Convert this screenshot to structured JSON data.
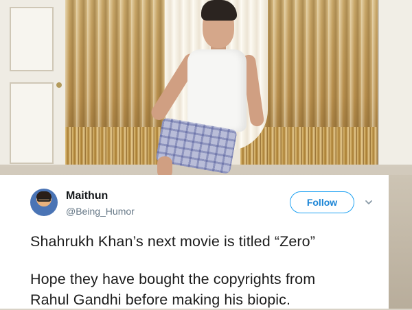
{
  "tweet": {
    "author_name": "Maithun",
    "author_handle": "@Being_Humor",
    "follow_label": "Follow",
    "text_line1": "Shahrukh Khan’s next movie is titled “Zero”",
    "text_line2": "Hope they have bought the copyrights from",
    "text_line3": "Rahul Gandhi before making his biopic."
  },
  "icons": {
    "avatar": "avatar",
    "menu": "chevron-down-icon"
  },
  "colors": {
    "follow_border": "#1da1f2",
    "follow_text": "#1b85d6",
    "handle_text": "#657786"
  }
}
